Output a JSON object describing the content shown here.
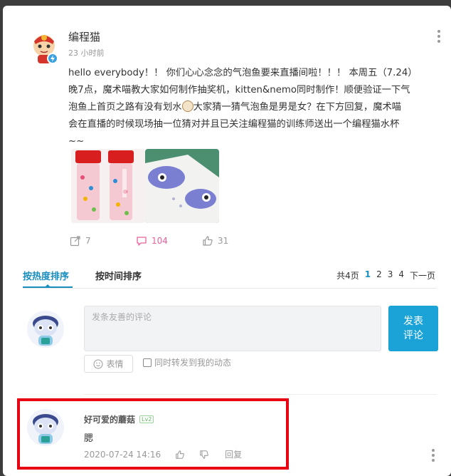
{
  "post": {
    "author": "编程猫",
    "time": "23 小时前",
    "body_line1": "hello everybody！！ 你们心心念念的气泡鱼要来直播间啦！！！ 本周五（7.24）",
    "body_line2": "晚7点，魔术喵教大家如何制作抽奖机，kitten&nemo同时制作！顺便验证一下气",
    "body_line3a": "泡鱼上首页之路有没有划水",
    "body_line3b": "大家猜一猜气泡鱼是男是女？在下方回复，魔术喵",
    "body_line4": "会在直播的时候现场抽一位猜对并且已关注编程猫的训练师送出一个编程猫水杯",
    "body_line5": "~~",
    "share_count": "7",
    "comment_count": "104",
    "like_count": "31"
  },
  "tabs": {
    "hot": "按热度排序",
    "time": "按时间排序"
  },
  "pager": {
    "total": "共4页",
    "pages": [
      "1",
      "2",
      "3",
      "4"
    ],
    "next": "下一页"
  },
  "composer": {
    "placeholder": "发条友善的评论",
    "publish_line1": "发表",
    "publish_line2": "评论",
    "emoji_label": "表情",
    "repost_label": "同时转发到我的动态"
  },
  "comment": {
    "author": "好可爱的蘑菇",
    "level": "Lv2",
    "text": "腮",
    "time": "2020-07-24 14:16",
    "reply_label": "回复"
  },
  "colors": {
    "accent": "#1a8ebe",
    "publish": "#1ba3d8",
    "highlight": "#e60012",
    "comment_pink": "#e8609c"
  }
}
